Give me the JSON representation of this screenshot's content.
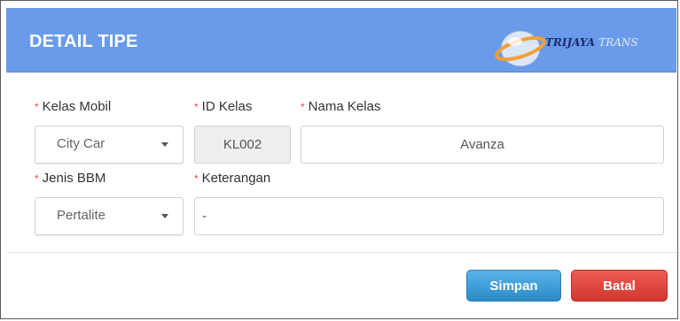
{
  "dialog": {
    "title": "DETAIL TIPE",
    "logo": {
      "brand_main": "TRIJAYA",
      "brand_secondary": "TRANS"
    }
  },
  "form": {
    "required_marker": "*",
    "kelas_mobil": {
      "label": "Kelas Mobil",
      "value": "City Car"
    },
    "id_kelas": {
      "label": "ID Kelas",
      "value": "KL002"
    },
    "nama_kelas": {
      "label": "Nama Kelas",
      "value": "Avanza"
    },
    "jenis_bbm": {
      "label": "Jenis BBM",
      "value": "Pertalite"
    },
    "keterangan": {
      "label": "Keterangan",
      "value": "-"
    }
  },
  "footer": {
    "save_label": "Simpan",
    "cancel_label": "Batal"
  },
  "colors": {
    "header_bg": "#6a9bea",
    "save_button": "#3a9ad6",
    "cancel_button": "#e0453e",
    "required": "#e8473d"
  },
  "icons": {
    "logo": "trijaya-globe-logo",
    "caret": "chevron-down-icon"
  }
}
